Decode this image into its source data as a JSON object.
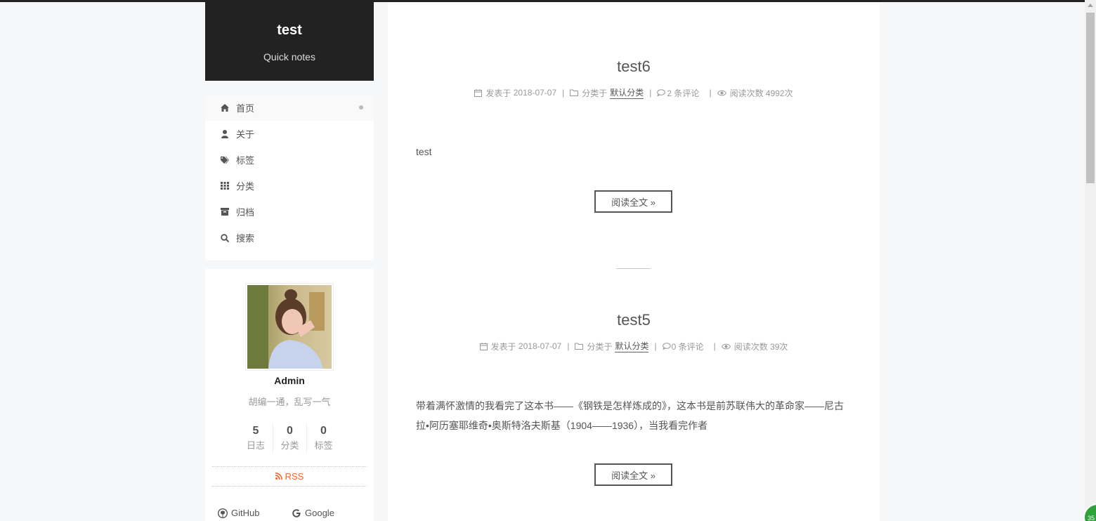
{
  "site": {
    "title": "test",
    "subtitle": "Quick notes"
  },
  "menu": [
    {
      "label": "首页",
      "icon": "home-icon",
      "active": true
    },
    {
      "label": "关于",
      "icon": "user-icon"
    },
    {
      "label": "标签",
      "icon": "tags-icon"
    },
    {
      "label": "分类",
      "icon": "th-icon"
    },
    {
      "label": "归档",
      "icon": "archive-icon"
    },
    {
      "label": "搜索",
      "icon": "search-icon"
    }
  ],
  "profile": {
    "name": "Admin",
    "motto": "胡编一通，乱写一气",
    "stats": [
      {
        "count": "5",
        "label": "日志"
      },
      {
        "count": "0",
        "label": "分类"
      },
      {
        "count": "0",
        "label": "标签"
      }
    ],
    "rss": "RSS",
    "social": [
      {
        "label": "GitHub",
        "icon": "github-icon"
      },
      {
        "label": "Google",
        "icon": "google-icon"
      }
    ]
  },
  "posts": [
    {
      "title": "test6",
      "posted_label": "发表于",
      "date": "2018-07-07",
      "category_label": "分类于",
      "category": "默认分类",
      "comments": "2 条评论",
      "views": "阅读次数 4992次",
      "excerpt": "test",
      "more": "阅读全文 »"
    },
    {
      "title": "test5",
      "posted_label": "发表于",
      "date": "2018-07-07",
      "category_label": "分类于",
      "category": "默认分类",
      "comments": "0 条评论",
      "views": "阅读次数 39次",
      "excerpt": "带着满怀激情的我看完了这本书——《钢铁是怎样炼成的》，这本书是前苏联伟大的革命家——尼古拉•阿历塞耶维奇•奥斯特洛夫斯基（1904——1936），当我看完作者",
      "more": "阅读全文 »"
    }
  ],
  "back_to_top": "35",
  "colors": {
    "brand_bg": "#222222",
    "rss": "#fc6423",
    "page_bg": "#f5f7f9"
  }
}
